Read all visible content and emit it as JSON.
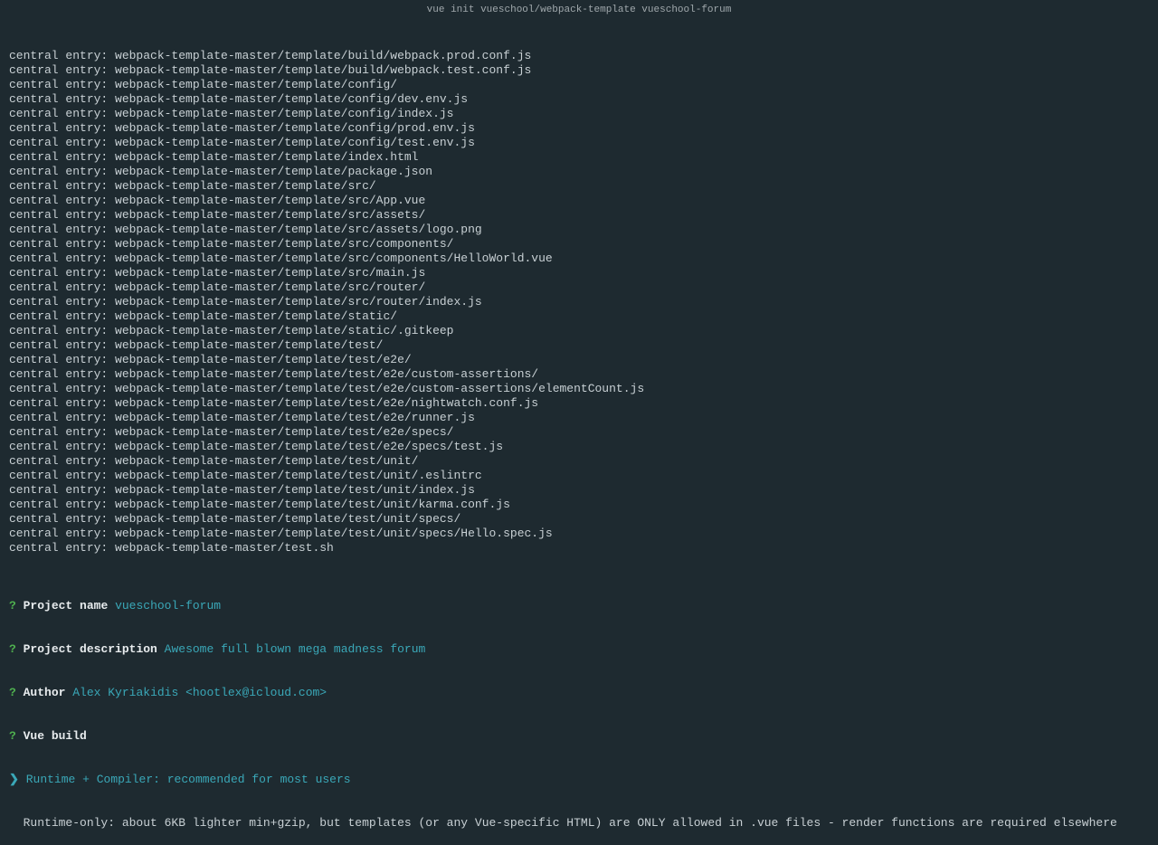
{
  "titlebar": "vue init vueschool/webpack-template vueschool-forum",
  "entries": [
    "central entry: webpack-template-master/template/build/webpack.prod.conf.js",
    "central entry: webpack-template-master/template/build/webpack.test.conf.js",
    "central entry: webpack-template-master/template/config/",
    "central entry: webpack-template-master/template/config/dev.env.js",
    "central entry: webpack-template-master/template/config/index.js",
    "central entry: webpack-template-master/template/config/prod.env.js",
    "central entry: webpack-template-master/template/config/test.env.js",
    "central entry: webpack-template-master/template/index.html",
    "central entry: webpack-template-master/template/package.json",
    "central entry: webpack-template-master/template/src/",
    "central entry: webpack-template-master/template/src/App.vue",
    "central entry: webpack-template-master/template/src/assets/",
    "central entry: webpack-template-master/template/src/assets/logo.png",
    "central entry: webpack-template-master/template/src/components/",
    "central entry: webpack-template-master/template/src/components/HelloWorld.vue",
    "central entry: webpack-template-master/template/src/main.js",
    "central entry: webpack-template-master/template/src/router/",
    "central entry: webpack-template-master/template/src/router/index.js",
    "central entry: webpack-template-master/template/static/",
    "central entry: webpack-template-master/template/static/.gitkeep",
    "central entry: webpack-template-master/template/test/",
    "central entry: webpack-template-master/template/test/e2e/",
    "central entry: webpack-template-master/template/test/e2e/custom-assertions/",
    "central entry: webpack-template-master/template/test/e2e/custom-assertions/elementCount.js",
    "central entry: webpack-template-master/template/test/e2e/nightwatch.conf.js",
    "central entry: webpack-template-master/template/test/e2e/runner.js",
    "central entry: webpack-template-master/template/test/e2e/specs/",
    "central entry: webpack-template-master/template/test/e2e/specs/test.js",
    "central entry: webpack-template-master/template/test/unit/",
    "central entry: webpack-template-master/template/test/unit/.eslintrc",
    "central entry: webpack-template-master/template/test/unit/index.js",
    "central entry: webpack-template-master/template/test/unit/karma.conf.js",
    "central entry: webpack-template-master/template/test/unit/specs/",
    "central entry: webpack-template-master/template/test/unit/specs/Hello.spec.js",
    "central entry: webpack-template-master/test.sh"
  ],
  "prompts": {
    "qmark": "?",
    "name_label": "Project name",
    "name_value": "vueschool-forum",
    "desc_label": "Project description",
    "desc_value": "Awesome full blown mega madness forum",
    "author_label": "Author",
    "author_value": "Alex Kyriakidis <hootlex@icloud.com>",
    "build_label": "Vue build",
    "arrow": "❯",
    "opt_selected": "Runtime + Compiler: recommended for most users",
    "opt_other": "Runtime-only: about 6KB lighter min+gzip, but templates (or any Vue-specific HTML) are ONLY allowed in .vue files - render functions are required elsewhere"
  }
}
